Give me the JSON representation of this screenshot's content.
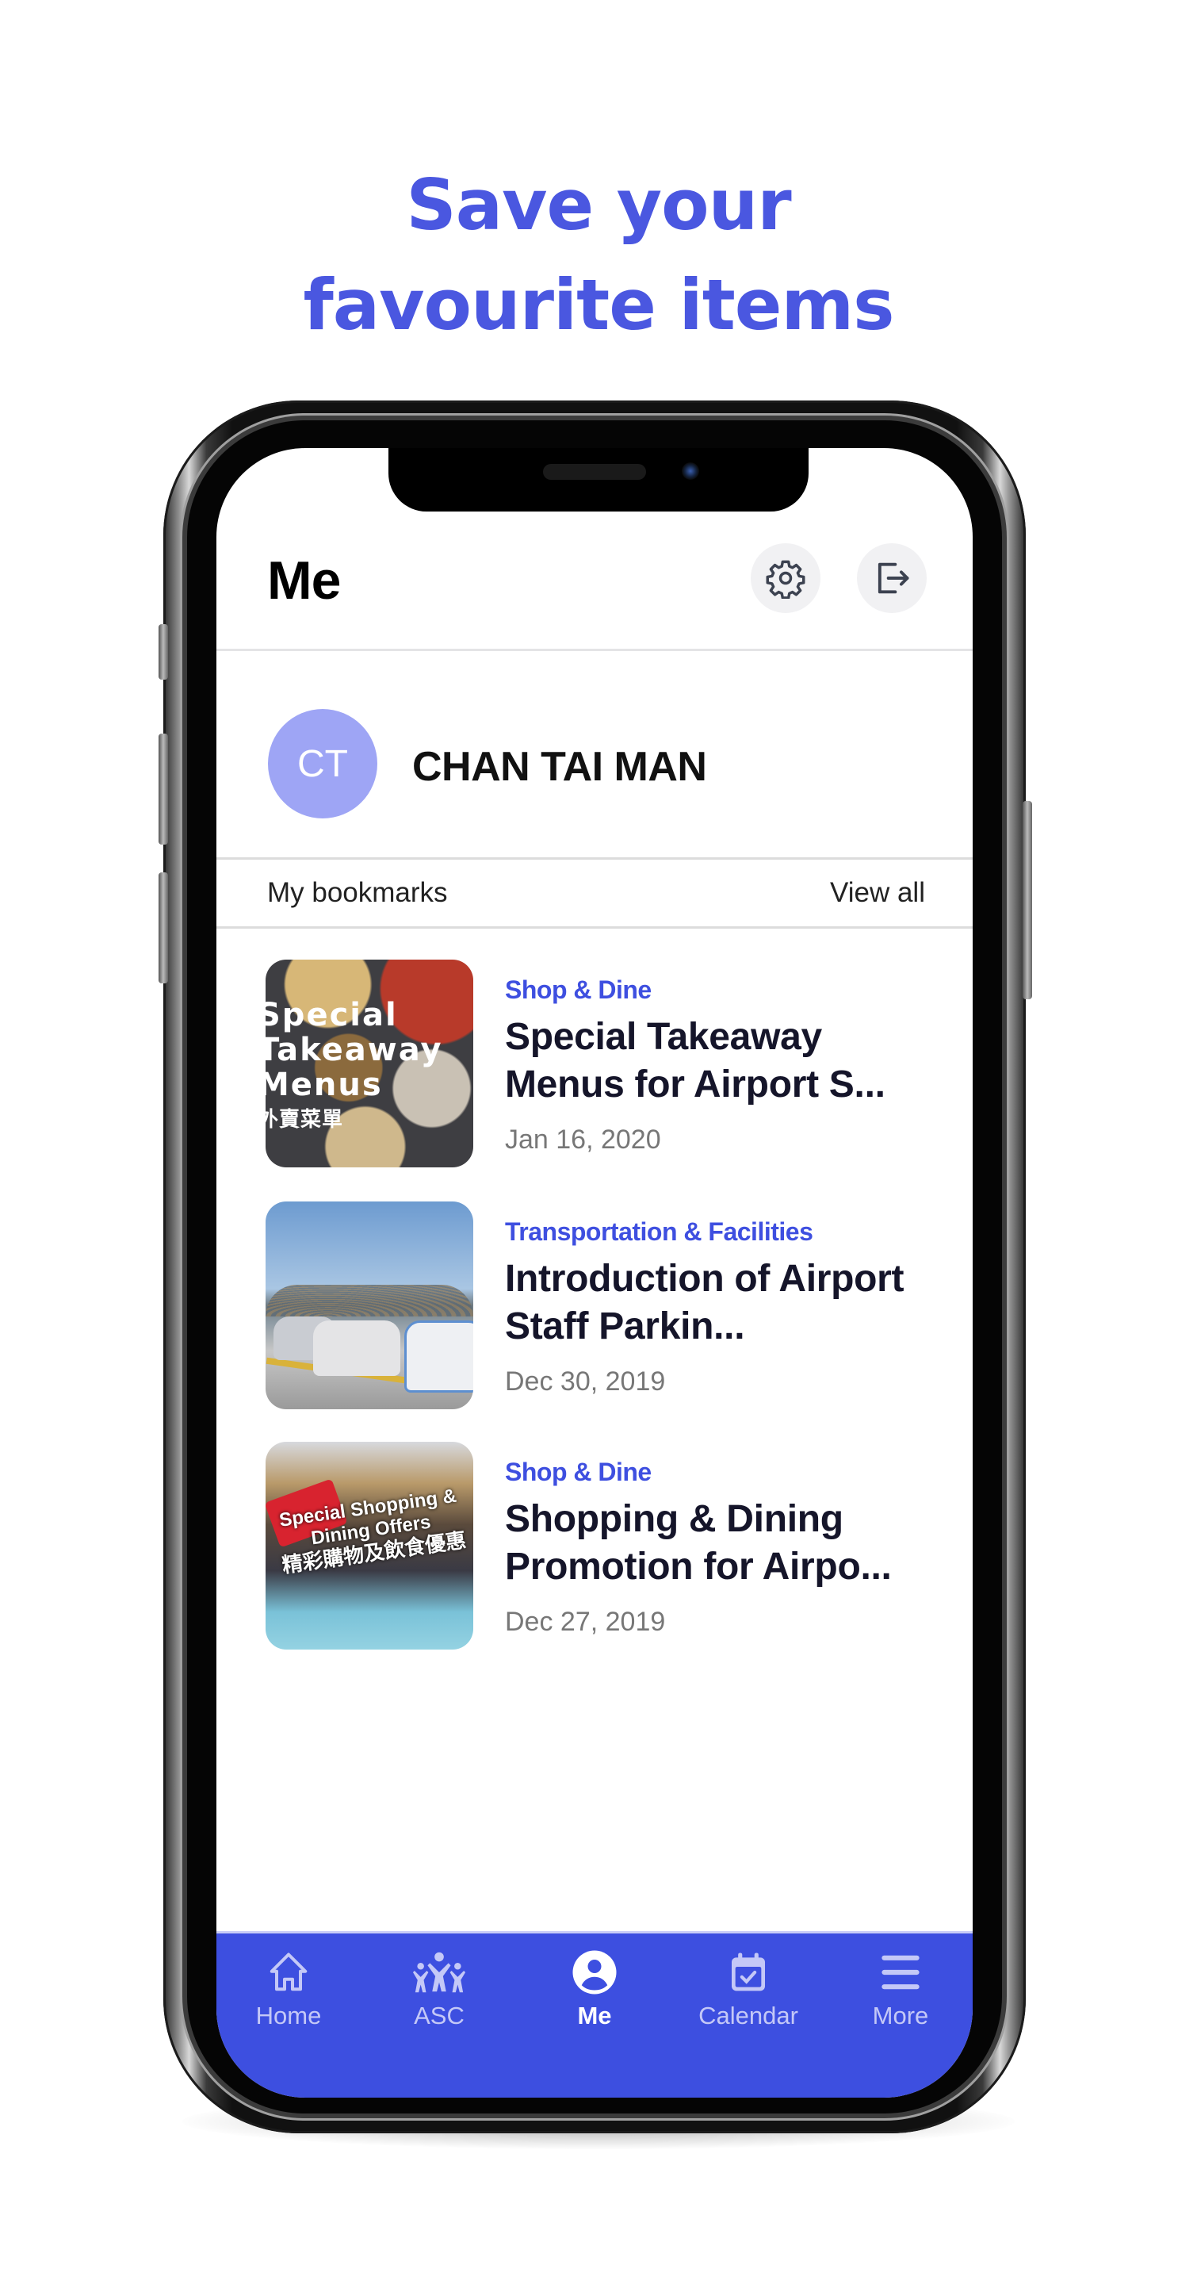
{
  "promo": {
    "headline_line1": "Save your",
    "headline_line2": "favourite items",
    "accent_color": "#4a57e0"
  },
  "app": {
    "header": {
      "title": "Me",
      "actions": [
        {
          "name": "settings",
          "icon": "gear-icon"
        },
        {
          "name": "logout",
          "icon": "logout-icon"
        }
      ]
    },
    "profile": {
      "initials": "CT",
      "name": "CHAN TAI MAN",
      "avatar_color": "#9ea5f5"
    },
    "bookmarks": {
      "section_title": "My bookmarks",
      "view_all_label": "View all",
      "items": [
        {
          "category": "Shop & Dine",
          "title": "Special Takeaway Menus for Airport S...",
          "date": "Jan 16, 2020",
          "thumbnail_text": "Special Takeaway Menus",
          "thumbnail_text_zh": "外賣菜單"
        },
        {
          "category": "Transportation & Facilities",
          "title": "Introduction of Airport Staff Parkin...",
          "date": "Dec 30, 2019"
        },
        {
          "category": "Shop & Dine",
          "title": "Shopping & Dining Promotion for Airpo...",
          "date": "Dec 27, 2019",
          "thumbnail_text": "Special Shopping & Dining Offers",
          "thumbnail_text_zh": "精彩購物及飲食優惠"
        }
      ]
    },
    "tabbar": {
      "color": "#3d4fe0",
      "active_index": 2,
      "tabs": [
        {
          "label": "Home",
          "icon": "home-icon"
        },
        {
          "label": "ASC",
          "icon": "people-icon"
        },
        {
          "label": "Me",
          "icon": "user-circle-icon"
        },
        {
          "label": "Calendar",
          "icon": "calendar-icon"
        },
        {
          "label": "More",
          "icon": "menu-icon"
        }
      ]
    }
  }
}
